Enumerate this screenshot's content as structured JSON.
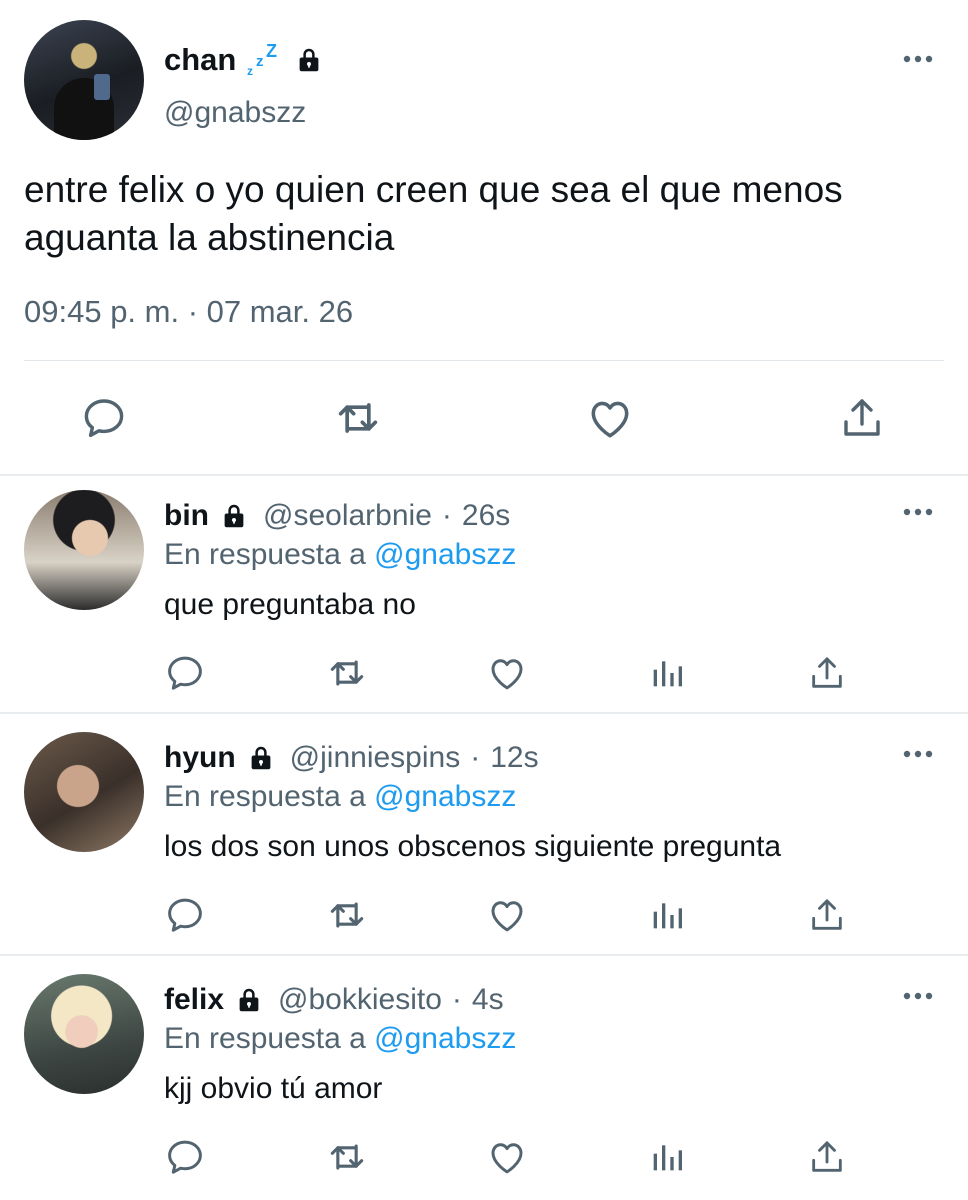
{
  "main_tweet": {
    "author": {
      "name": "chan",
      "handle": "@gnabszz"
    },
    "text": "entre felix o yo quien creen que sea el que menos aguanta la abstinencia",
    "timestamp": "09:45 p. m. · 07 mar. 26",
    "icons": {
      "status": "zzz-icon",
      "protected": "lock-icon",
      "more": "more-icon"
    }
  },
  "replies": [
    {
      "name": "bin",
      "handle": "@seolarbnie",
      "separator": "·",
      "age": "26s",
      "reply_to_label": "En respuesta a",
      "reply_to_handle": "@gnabszz",
      "text": "que preguntaba no"
    },
    {
      "name": "hyun",
      "handle": "@jinniespins",
      "separator": "·",
      "age": "12s",
      "reply_to_label": "En respuesta a",
      "reply_to_handle": "@gnabszz",
      "text": "los dos son unos obscenos siguiente pregunta"
    },
    {
      "name": "felix",
      "handle": "@bokkiesito",
      "separator": "·",
      "age": "4s",
      "reply_to_label": "En respuesta a",
      "reply_to_handle": "@gnabszz",
      "text": "kjj obvio tú amor"
    }
  ],
  "colors": {
    "text": "#0f1419",
    "secondary": "#536471",
    "link": "#1d9bf0",
    "divider": "#e1e6ea",
    "zzz": "#1d9bf0"
  }
}
